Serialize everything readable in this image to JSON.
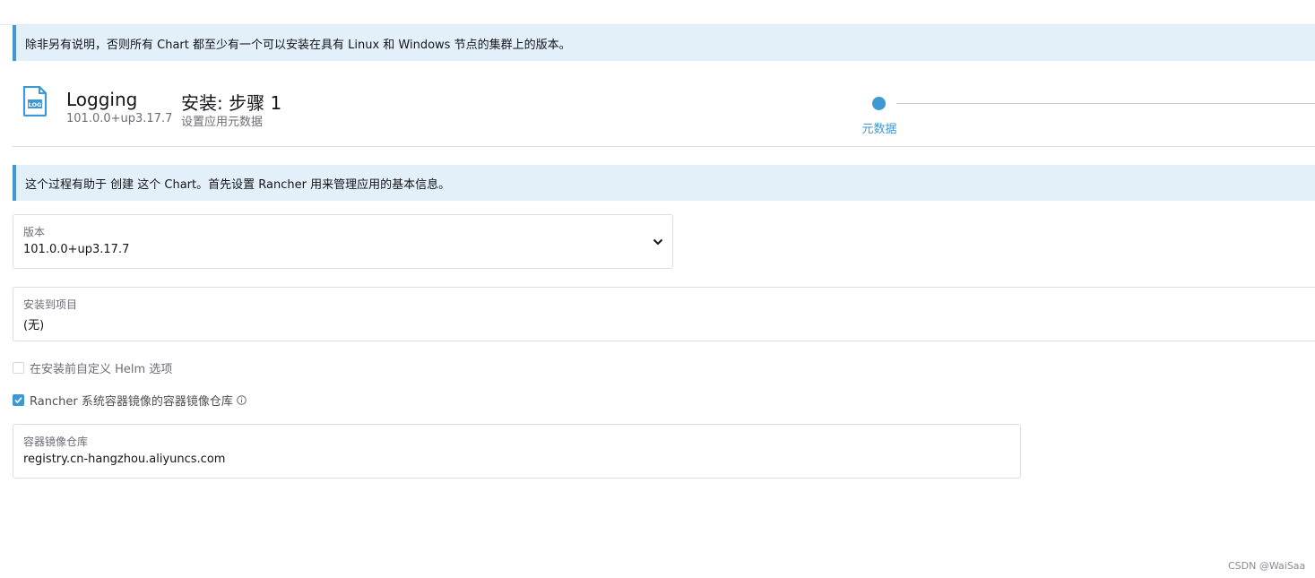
{
  "banners": {
    "windows_notice": "除非另有说明，否则所有 Chart 都至少有一个可以安装在具有 Linux 和 Windows 节点的集群上的版本。",
    "process_notice": "这个过程有助于 创建 这个 Chart。首先设置 Rancher 用来管理应用的基本信息。"
  },
  "header": {
    "icon": "log-file-icon",
    "icon_text": "LOG",
    "app_name": "Logging",
    "app_version": "101.0.0+up3.17.7",
    "step_title": "安装: 步骤 1",
    "step_subtitle": "设置应用元数据"
  },
  "stepper": {
    "steps": [
      {
        "label": "元数据",
        "active": true
      }
    ]
  },
  "form": {
    "version": {
      "label": "版本",
      "value": "101.0.0+up3.17.7"
    },
    "project": {
      "label": "安装到项目",
      "value": "(无)"
    },
    "customize_helm": {
      "label": "在安装前自定义 Helm 选项",
      "checked": false
    },
    "system_registry": {
      "label": "Rancher 系统容器镜像的容器镜像仓库",
      "checked": true
    },
    "registry": {
      "label": "容器镜像仓库",
      "value": "registry.cn-hangzhou.aliyuncs.com"
    }
  },
  "watermark": "CSDN @WaiSaa",
  "colors": {
    "accent": "#3d98d3",
    "banner_bg": "#e3f0f9",
    "border": "#dcdee7"
  }
}
